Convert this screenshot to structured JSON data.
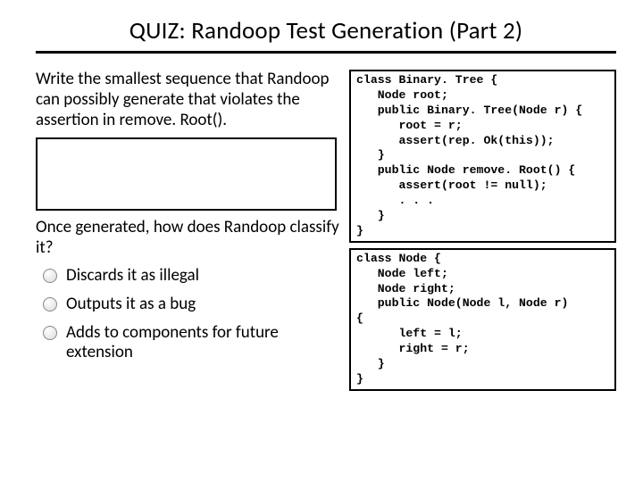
{
  "title": "QUIZ: Randoop Test Generation (Part 2)",
  "prompt": "Write the smallest sequence that Randoop can possibly generate that violates the assertion in remove. Root().",
  "question2": "Once generated, how does Randoop classify it?",
  "options": [
    "Discards it as illegal",
    "Outputs it as a bug",
    "Adds to components for future extension"
  ],
  "code1": "class Binary. Tree {\n   Node root;\n   public Binary. Tree(Node r) {\n      root = r;\n      assert(rep. Ok(this));\n   }\n   public Node remove. Root() {\n      assert(root != null);\n      . . .\n   }\n}",
  "code2": "class Node {\n   Node left;\n   Node right;\n   public Node(Node l, Node r)\n{\n      left = l;\n      right = r;\n   }\n}"
}
